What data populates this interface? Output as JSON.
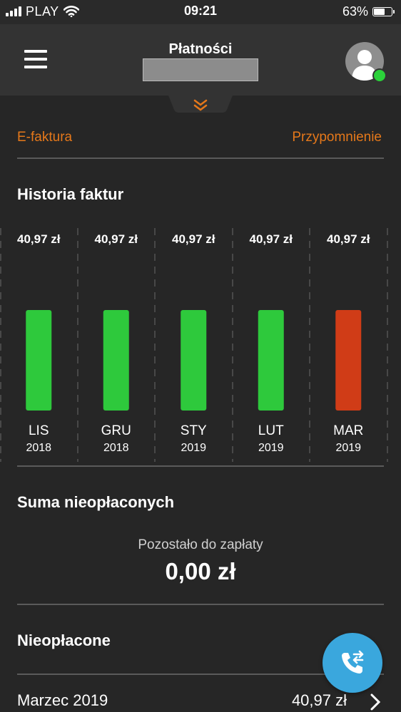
{
  "status_bar": {
    "carrier": "PLAY",
    "time": "09:21",
    "battery": "63%",
    "battery_level": 0.63
  },
  "header": {
    "title": "Płatności"
  },
  "links": {
    "efaktura": "E-faktura",
    "reminder": "Przypomnienie"
  },
  "history": {
    "title": "Historia faktur"
  },
  "chart_data": {
    "type": "bar",
    "categories": [
      "LIS",
      "GRU",
      "STY",
      "LUT",
      "MAR"
    ],
    "years": [
      "2018",
      "2018",
      "2019",
      "2019",
      "2019"
    ],
    "values": [
      40.97,
      40.97,
      40.97,
      40.97,
      40.97
    ],
    "value_labels": [
      "40,97 zł",
      "40,97 zł",
      "40,97 zł",
      "40,97 zł",
      "40,97 zł"
    ],
    "statuses": [
      "paid",
      "paid",
      "paid",
      "paid",
      "unpaid"
    ],
    "colors": {
      "paid": "#2ec93c",
      "unpaid": "#d03c17"
    },
    "title": "",
    "xlabel": "",
    "ylabel": ""
  },
  "unpaid_sum": {
    "title": "Suma nieopłaconych",
    "remaining_label": "Pozostało do zapłaty",
    "remaining_amount": "0,00 zł"
  },
  "unpaid": {
    "title": "Nieopłacone",
    "items": [
      {
        "month": "Marzec 2019",
        "amount": "40,97 zł"
      }
    ]
  },
  "colors": {
    "accent": "#e5781a",
    "background": "#262626",
    "header": "#333333",
    "fab": "#3aa7dd"
  }
}
